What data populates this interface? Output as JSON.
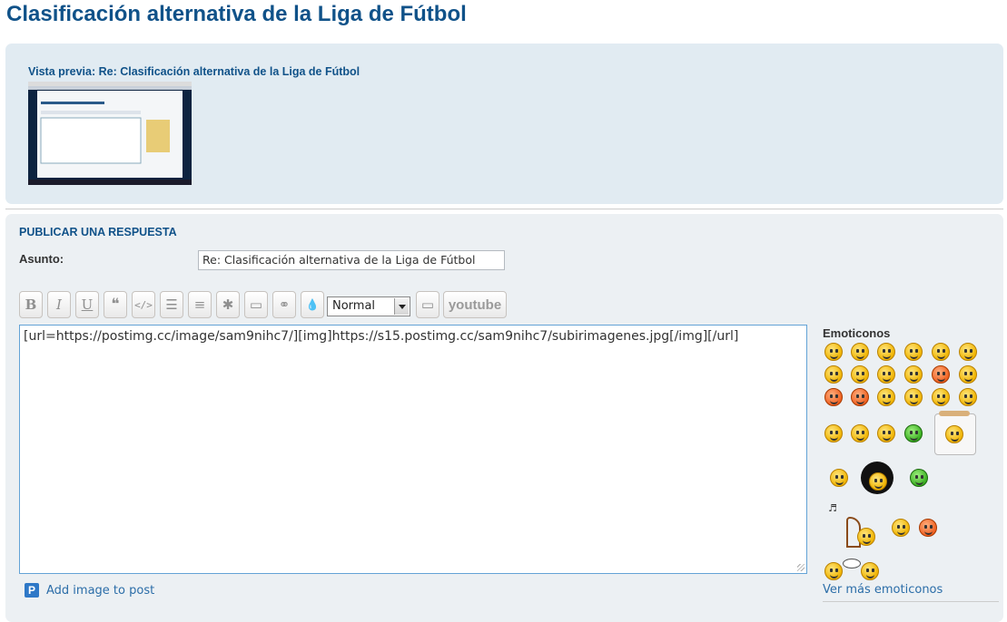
{
  "page": {
    "title": "Clasificación alternativa de la Liga de Fútbol"
  },
  "preview": {
    "label": "Vista previa: Re: Clasificación alternativa de la Liga de Fútbol"
  },
  "reply": {
    "heading": "PUBLICAR UNA RESPUESTA",
    "subject_label": "Asunto:",
    "subject_value": "Re: Clasificación alternativa de la Liga de Fútbol",
    "toolbar": {
      "bold": "B",
      "italic": "I",
      "underline": "U",
      "quote": "❝",
      "code": "</>",
      "list": "☰",
      "list_numbered": "≡",
      "list_item": "✱",
      "image": "▭",
      "link": "⚭",
      "color": "💧",
      "size_value": "Normal",
      "flash": "▭",
      "youtube": "youtube"
    },
    "editor_text": "[url=https://postimg.cc/image/sam9nihc7/][img]https://s15.postimg.cc/sam9nihc7/subirimagenes.jpg[/img][/url]",
    "add_image": "Add image to post"
  },
  "emoticons": {
    "title": "Emoticonos",
    "more_link": "Ver más emoticonos",
    "icons": [
      "smile-icon",
      "grin-icon",
      "sad-icon",
      "surprised-icon",
      "geek-icon",
      "wink-icon",
      "cool-icon",
      "laugh-icon",
      "razz-icon",
      "happy-icon",
      "angry-icon",
      "rolleyes-icon",
      "evil-icon",
      "twisted-icon",
      "eek-icon",
      "neutral-icon",
      "exclaim-icon",
      "question-icon",
      "idea-icon",
      "arrow-icon",
      "mrgreen-icon",
      "green-icon",
      "bug-icon",
      "banned-icon"
    ]
  }
}
